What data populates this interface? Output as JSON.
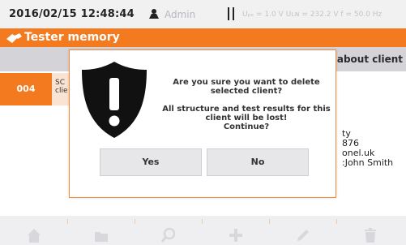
{
  "status": {
    "datetime": "2016/02/15 12:48:44",
    "user": "Admin",
    "measurements": "Uₚₑ = 1.0 V Uʟɴ = 232.2 V f = 50.0 Hz"
  },
  "title": "Tester memory",
  "table": {
    "header_right": "about client",
    "row": {
      "id": "004",
      "name_line1": "SC",
      "name_line2": "clie"
    }
  },
  "details": {
    "lines": [
      "ty",
      "876",
      "onel.uk",
      ":John Smith"
    ]
  },
  "dialog": {
    "line1": "Are you sure you want to delete",
    "line2": "selected client?",
    "line3": "All structure and test results for this",
    "line4": "client will be lost!",
    "line5": "Continue?",
    "yes_label": "Yes",
    "no_label": "No"
  },
  "toolbar": {
    "icons": [
      "home-icon",
      "folder-icon",
      "search-icon",
      "add-icon",
      "edit-icon",
      "delete-icon"
    ]
  },
  "colors": {
    "accent": "#f47a1f",
    "row_bg": "#fbe3d3",
    "header_bg": "#d4d4d8"
  }
}
